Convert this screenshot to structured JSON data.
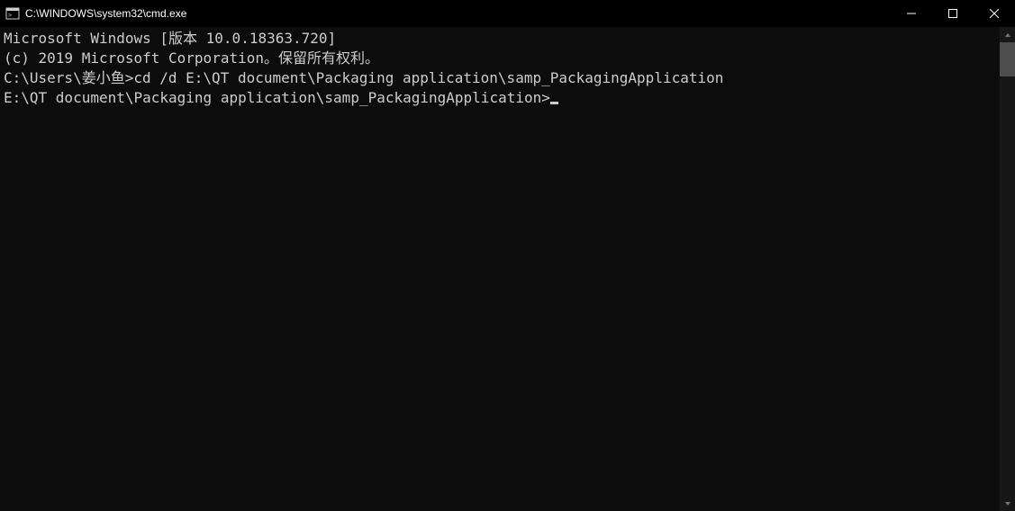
{
  "titlebar": {
    "title": "C:\\WINDOWS\\system32\\cmd.exe"
  },
  "terminal": {
    "line1": "Microsoft Windows [版本 10.0.18363.720]",
    "line2": "(c) 2019 Microsoft Corporation。保留所有权利。",
    "line3": "",
    "prompt1": "C:\\Users\\姜小鱼>",
    "cmd1": "cd /d E:\\QT document\\Packaging application\\samp_PackagingApplication",
    "line5": "",
    "prompt2": "E:\\QT document\\Packaging application\\samp_PackagingApplication>"
  }
}
